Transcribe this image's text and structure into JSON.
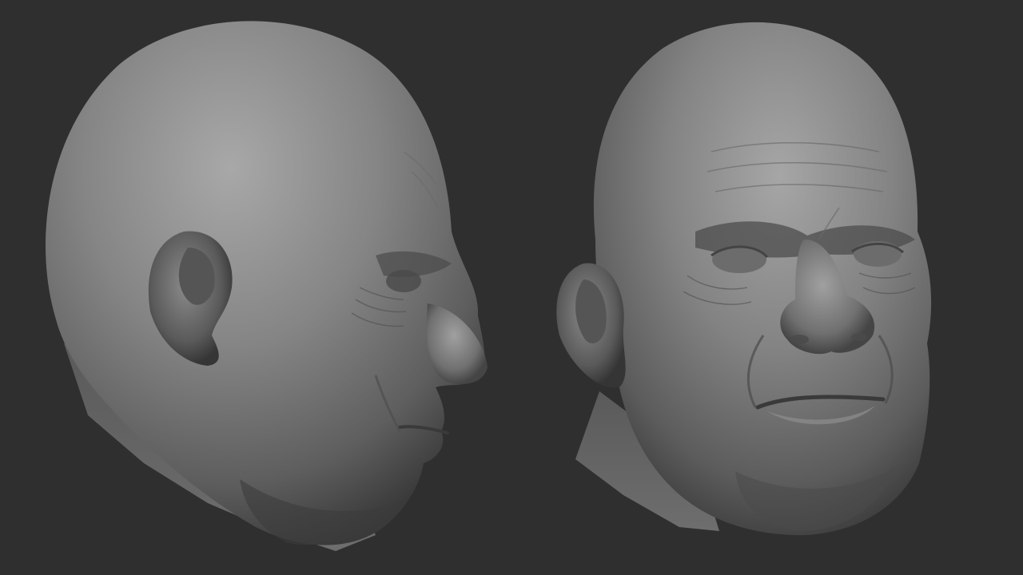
{
  "scene": {
    "background_color": "#2f2f2f",
    "clay_color": "#7a7a7a",
    "clay_shadow": "#3e3e3e",
    "clay_highlight": "#b4b4b4",
    "models": [
      {
        "view": "side-profile-right",
        "subject": "bald-head-sculpt"
      },
      {
        "view": "three-quarter-front",
        "subject": "bald-head-sculpt"
      }
    ]
  }
}
